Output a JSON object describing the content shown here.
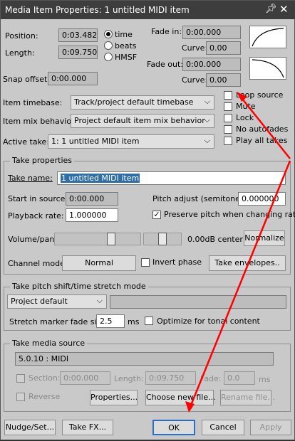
{
  "window": {
    "title": "Media Item Properties:  1 untitled MIDI item"
  },
  "position": {
    "position_label": "Position:",
    "position_value": "0:03.482",
    "length_label": "Length:",
    "length_value": "0:09.750",
    "snap_label": "Snap offset:",
    "snap_value": "0:00.000",
    "unit_options": [
      "time",
      "beats",
      "HMSF"
    ],
    "unit_selected": "time"
  },
  "fades": {
    "fade_in_label": "Fade in:",
    "fade_in_value": "0:00.000",
    "curve_label": "Curve:",
    "curve_in_value": "0.00",
    "fade_out_label": "Fade out:",
    "fade_out_value": "0:00.000",
    "curve_out_value": "0.00"
  },
  "item": {
    "timebase_label": "Item timebase:",
    "timebase_value": "Track/project default timebase",
    "mix_label": "Item mix behavior:",
    "mix_value": "Project default item mix behavior",
    "active_take_label": "Active take:",
    "active_take_value": "1: 1 untitled MIDI item"
  },
  "options": {
    "loop_source": "Loop source",
    "mute": "Mute",
    "lock": "Lock",
    "no_autofades": "No autofades",
    "play_all_takes": "Play all takes"
  },
  "take": {
    "group_title": "Take properties",
    "name_label": "Take name:",
    "name_value": "1 untitled MIDI item",
    "start_label": "Start in source:",
    "start_value": "0:00.000",
    "pitch_label": "Pitch adjust (semitones):",
    "pitch_value": "0.000000",
    "rate_label": "Playback rate:",
    "rate_value": "1.000000",
    "preserve_pitch": "Preserve pitch when changing rate",
    "preserve_checked": true,
    "volpan_label": "Volume/pan:",
    "volpan_readout": "0.00dB  center",
    "normalize": "Normalize",
    "channel_label": "Channel mode:",
    "channel_value": "Normal",
    "invert_phase": "Invert phase",
    "take_envelopes": "Take envelopes.."
  },
  "stretch": {
    "group_title": "Take pitch shift/time stretch mode",
    "mode_value": "Project default",
    "fade_label": "Stretch marker fade size:",
    "fade_value": "2.5",
    "fade_unit": "ms",
    "tonal": "Optimize for tonal content"
  },
  "media": {
    "group_title": "Take media source",
    "source_value": "5.0.10 : MIDI",
    "section_label": "Section:",
    "section_value": "0:00.000",
    "length_label": "Length:",
    "length_value": "0:09.750",
    "fade_label": "Fade:",
    "fade_value": "0.0",
    "fade_unit": "ms",
    "reverse_label": "Reverse",
    "properties": "Properties...",
    "choose": "Choose new file...",
    "rename": "Rename file..."
  },
  "footer": {
    "nudge": "Nudge/Set...",
    "take_fx": "Take FX...",
    "ok": "OK",
    "cancel": "Cancel",
    "apply": "Apply"
  },
  "annotation_color": "#ff0000"
}
